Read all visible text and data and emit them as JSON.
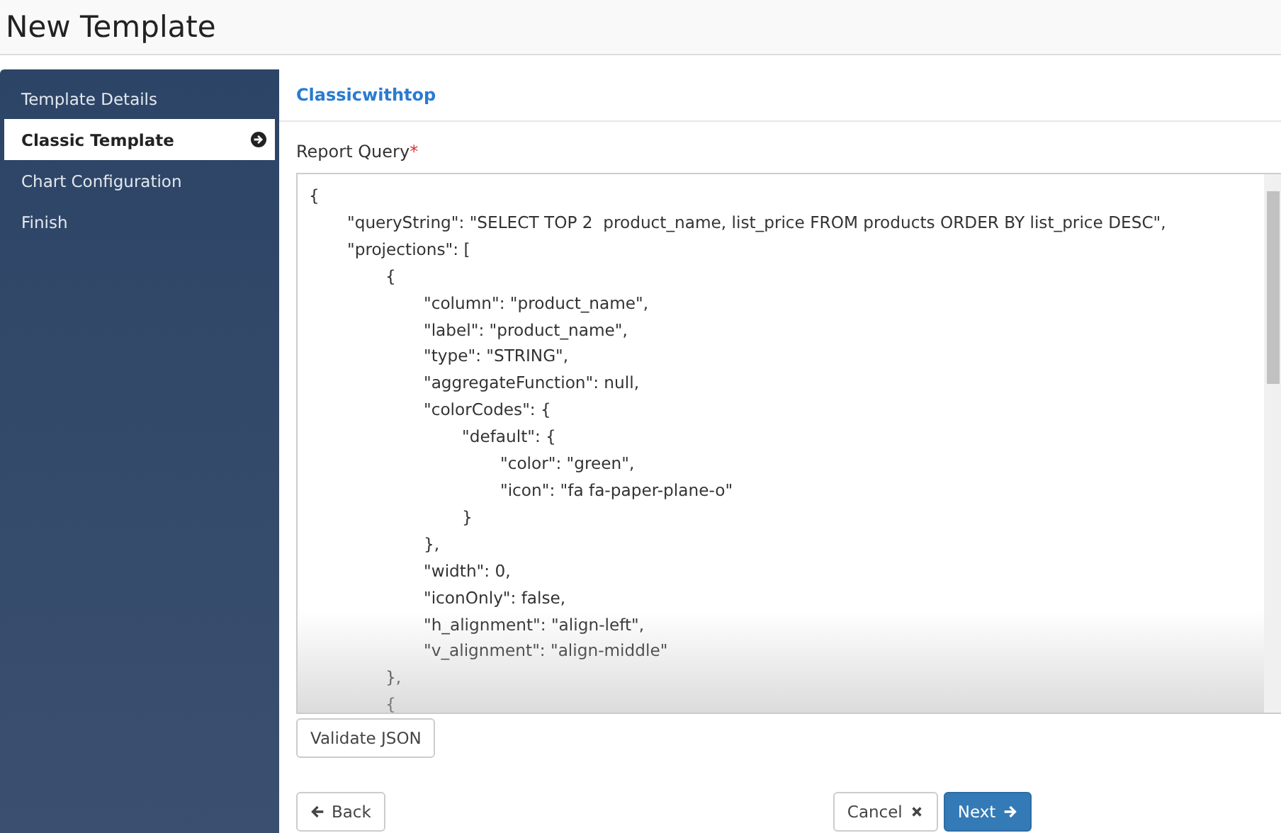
{
  "page_title": "New Template",
  "sidebar": {
    "items": [
      {
        "label": "Template Details",
        "selected": false
      },
      {
        "label": "Classic Template",
        "selected": true
      },
      {
        "label": "Chart Configuration",
        "selected": false
      },
      {
        "label": "Finish",
        "selected": false
      }
    ]
  },
  "template_link": "Classicwithtop",
  "report_query": {
    "label": "Report Query",
    "required_mark": "*",
    "lines": [
      "{",
      "\t\"queryString\": \"SELECT TOP 2  product_name, list_price FROM products ORDER BY list_price DESC\",",
      "\t\"projections\": [",
      "\t\t{",
      "\t\t\t\"column\": \"product_name\",",
      "\t\t\t\"label\": \"product_name\",",
      "\t\t\t\"type\": \"STRING\",",
      "\t\t\t\"aggregateFunction\": null,",
      "\t\t\t\"colorCodes\": {",
      "\t\t\t\t\"default\": {",
      "\t\t\t\t\t\"color\": \"green\",",
      "\t\t\t\t\t\"icon\": \"fa fa-paper-plane-o\"",
      "\t\t\t\t}",
      "\t\t\t},",
      "\t\t\t\"width\": 0,",
      "\t\t\t\"iconOnly\": false,",
      "\t\t\t\"h_alignment\": \"align-left\",",
      "\t\t\t\"v_alignment\": \"align-middle\"",
      "\t\t},",
      "\t\t{"
    ]
  },
  "validate_button": "Validate JSON",
  "buttons": {
    "back": "Back",
    "cancel": "Cancel",
    "next": "Next"
  }
}
